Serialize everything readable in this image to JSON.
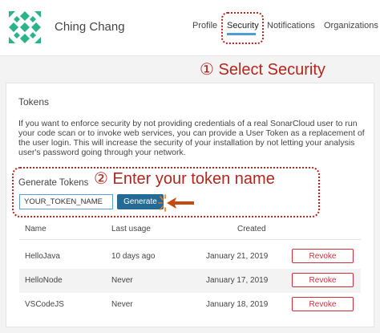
{
  "header": {
    "user_name": "Ching Chang",
    "avatar_icon": "identicon-avatar",
    "tabs": [
      {
        "label": "Profile",
        "active": false
      },
      {
        "label": "Security",
        "active": true
      },
      {
        "label": "Notifications",
        "active": false
      },
      {
        "label": "Organizations",
        "active": false
      }
    ]
  },
  "annotations": {
    "step1": "① Select Security",
    "step2": "② Enter your token name"
  },
  "tokens": {
    "title": "Tokens",
    "description": "If you want to enforce security by not providing credentials of a real SonarCloud user to run your code scan or to invoke web services, you can provide a User Token as a replacement of the user login. This will increase the security of your installation by not letting your analysis user's password going through your network.",
    "generate": {
      "title": "Generate Tokens",
      "input_value": "YOUR_TOKEN_NAME",
      "button_label": "Generate"
    },
    "table": {
      "headers": {
        "name": "Name",
        "last_usage": "Last usage",
        "created": "Created"
      },
      "rows": [
        {
          "name": "HelloJava",
          "last_usage": "10 days ago",
          "created": "January 21, 2019",
          "action": "Revoke"
        },
        {
          "name": "HelloNode",
          "last_usage": "Never",
          "created": "January 17, 2019",
          "action": "Revoke"
        },
        {
          "name": "VSCodeJS",
          "last_usage": "Never",
          "created": "January 18, 2019",
          "action": "Revoke"
        }
      ]
    }
  },
  "colors": {
    "accent": "#4b9fd5",
    "button_primary": "#236a97",
    "danger": "#d02f3a",
    "annotation": "#b3261e",
    "avatar": "#2bb38a"
  }
}
